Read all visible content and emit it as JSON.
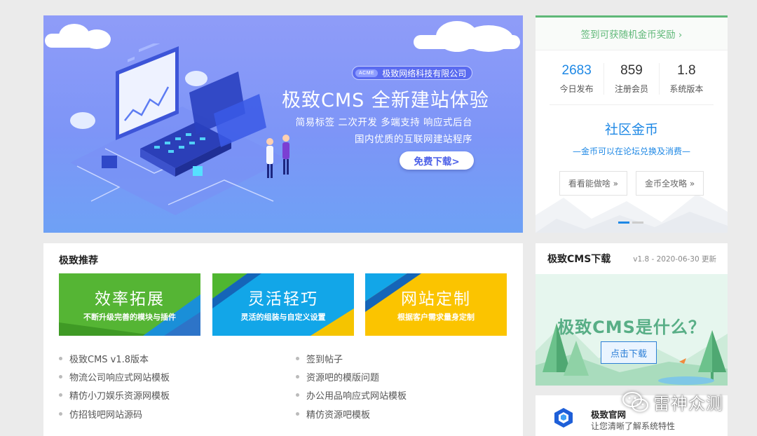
{
  "banner": {
    "company_tag_prefix": "ACME",
    "company_name": "极致网络科技有限公司",
    "title": "极致CMS 全新建站体验",
    "subtitle_line1": "简易标签 二次开发 多端支持 响应式后台",
    "subtitle_line2": "国内优质的互联网建站程序",
    "download_button": "免费下载>"
  },
  "sign_panel": {
    "sign_link": "签到可获随机金币奖励 ›",
    "stats": [
      {
        "value": "2683",
        "label": "今日发布"
      },
      {
        "value": "859",
        "label": "注册会员"
      },
      {
        "value": "1.8",
        "label": "系统版本"
      }
    ],
    "coin_title": "社区金币",
    "coin_desc": "—金币可以在论坛兑换及消费—",
    "buttons": [
      "看看能做啥 »",
      "金币全攻略 »"
    ],
    "carousel_active_index": 0
  },
  "recommend": {
    "title": "极致推荐",
    "cards": [
      {
        "title": "效率拓展",
        "subtitle": "不断升级完善的模块与插件",
        "color": "#55b534"
      },
      {
        "title": "灵活轻巧",
        "subtitle": "灵活的组装与自定义设置",
        "color": "#12a6e8"
      },
      {
        "title": "网站定制",
        "subtitle": "根据客户需求量身定制",
        "color": "#fbc400"
      }
    ],
    "links_left": [
      "极致CMS v1.8版本",
      "物流公司响应式网站模板",
      "精仿小刀娱乐资源网模板",
      "仿招钱吧网站源码"
    ],
    "links_right": [
      "签到帖子",
      "资源吧的模版问题",
      "办公用品响应式网站模板",
      "精仿资源吧模板"
    ]
  },
  "download_panel": {
    "title": "极致CMS下载",
    "meta": "v1.8 - 2020-06-30 更新",
    "headline": "极致CMS是什么？",
    "button": "点击下载"
  },
  "official": {
    "name": "极致官网",
    "desc": "让您清晰了解系统特性"
  },
  "watermark": {
    "text": "雷神众测"
  },
  "colors": {
    "accent_green": "#5fb878",
    "accent_blue": "#1e88e5",
    "banner_gradient_top": "#8f9cf8",
    "banner_gradient_bottom": "#6ea1f5"
  }
}
